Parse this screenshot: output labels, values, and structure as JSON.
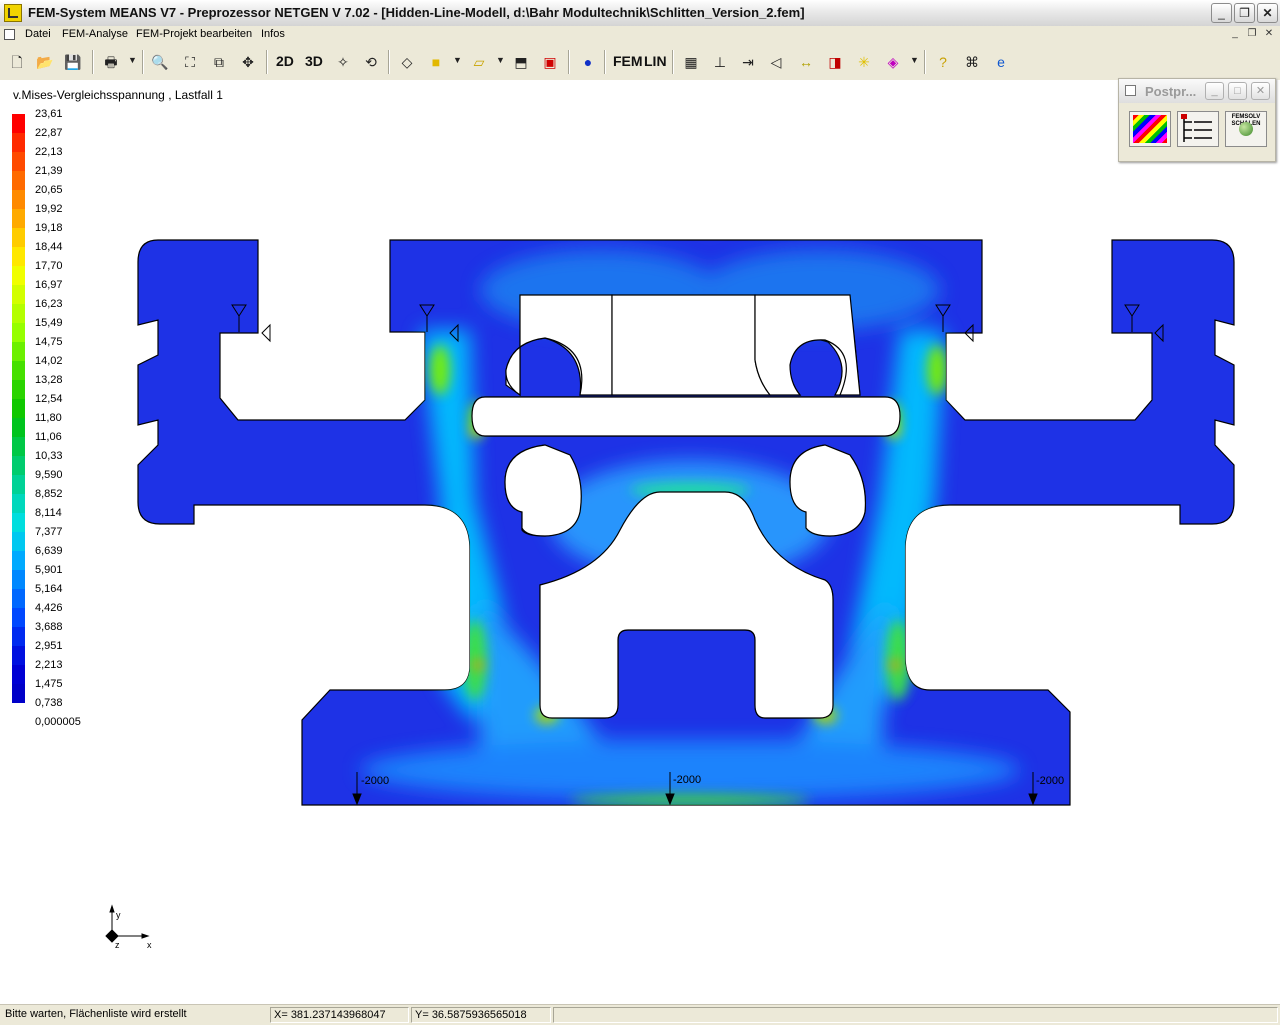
{
  "window": {
    "title": "FEM-System MEANS V7 - Preprozessor NETGEN V 7.02 - [Hidden-Line-Modell,  d:\\Bahr Modultechnik\\Schlitten_Version_2.fem]",
    "minimize": "_",
    "maximize": "❐",
    "close": "✕"
  },
  "menu": {
    "items": [
      "Datei",
      "FEM-Analyse",
      "FEM-Projekt bearbeiten",
      "Infos"
    ],
    "mdi_minimize": "_",
    "mdi_restore": "❐",
    "mdi_close": "✕"
  },
  "toolbar": {
    "label_2d": "2D",
    "label_3d": "3D",
    "label_fem": "FEM",
    "label_lin": "LIN"
  },
  "view": {
    "result_label": "v.Mises-Vergleichsspannung , Lastfall  1",
    "load_labels": [
      "-2000",
      "-2000",
      "-2000"
    ],
    "axis_y": "y",
    "axis_z": "z",
    "axis_x": "x"
  },
  "legend": {
    "values": [
      "23,61",
      "22,87",
      "22,13",
      "21,39",
      "20,65",
      "19,92",
      "19,18",
      "18,44",
      "17,70",
      "16,97",
      "16,23",
      "15,49",
      "14,75",
      "14,02",
      "13,28",
      "12,54",
      "11,80",
      "11,06",
      "10,33",
      "9,590",
      "8,852",
      "8,114",
      "7,377",
      "6,639",
      "5,901",
      "5,164",
      "4,426",
      "3,688",
      "2,951",
      "2,213",
      "1,475",
      "0,738",
      "0,000005"
    ],
    "colors": [
      "#ff0000",
      "#ff2a00",
      "#ff4a00",
      "#ff6a00",
      "#ff8a00",
      "#ffaa00",
      "#ffcc00",
      "#ffe800",
      "#f0ff00",
      "#d2ff00",
      "#b4ff00",
      "#96ff00",
      "#6cf000",
      "#46e000",
      "#2ad400",
      "#10c800",
      "#00c41e",
      "#00c846",
      "#00cc6e",
      "#00d296",
      "#00d8bc",
      "#00dede",
      "#00c8f0",
      "#00aaff",
      "#0088ff",
      "#0068ff",
      "#0048ff",
      "#002af0",
      "#0010e0",
      "#0000d4",
      "#0000c8"
    ]
  },
  "postprocessor": {
    "title": "Postpr...",
    "femsolv_label": "FEMSOLV SCHALEN",
    "min": "_",
    "max": "□",
    "close": "✕"
  },
  "status": {
    "message": "Bitte warten, Flächenliste wird erstellt",
    "x": "X=  381.237143968047",
    "y": "Y=  36.5875936565018"
  }
}
